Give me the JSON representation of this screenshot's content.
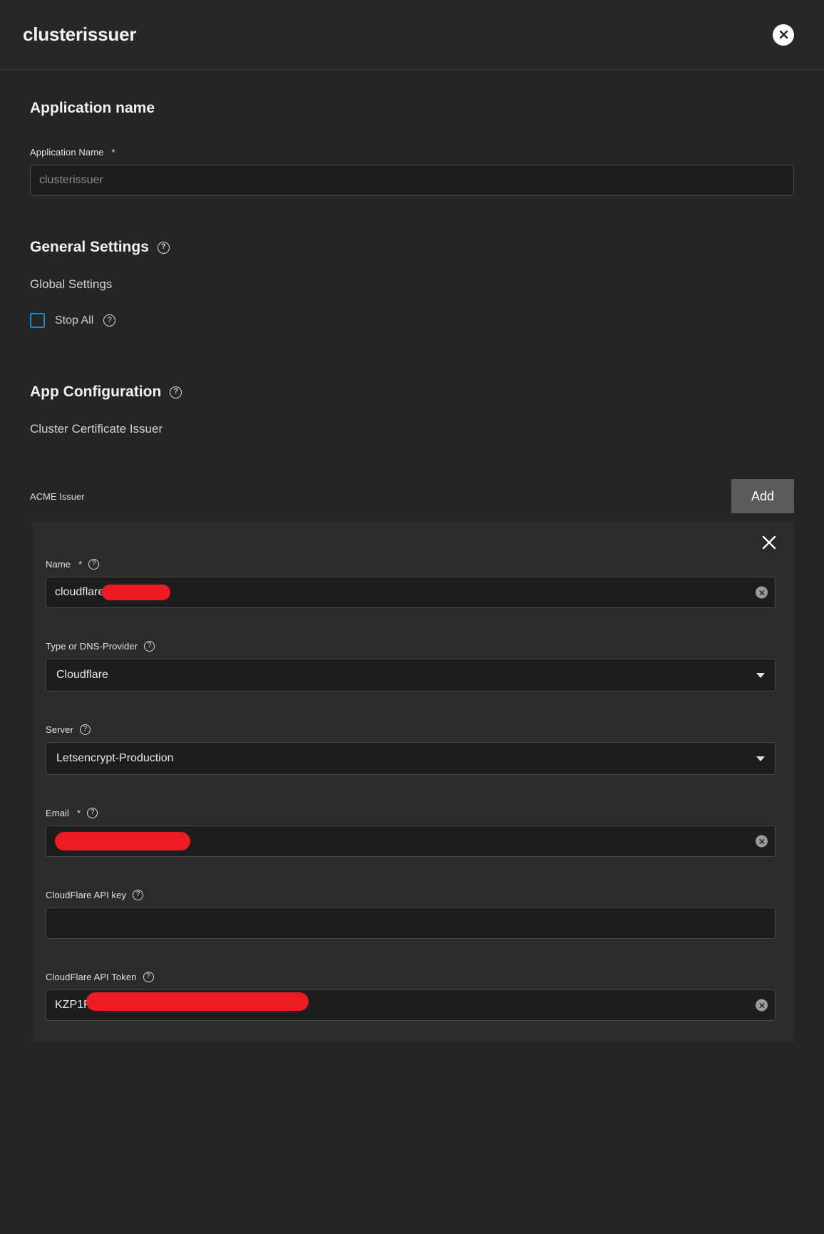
{
  "header": {
    "title": "clusterissuer",
    "close_icon": "close-icon"
  },
  "app_name_section": {
    "heading": "Application name",
    "field_label": "Application Name",
    "required_mark": "*",
    "input_placeholder": "clusterissuer",
    "input_value": ""
  },
  "general_settings": {
    "heading": "General Settings",
    "help_icon": "help-circle-icon",
    "subheading": "Global Settings",
    "stop_all": {
      "label": "Stop All",
      "checked": false,
      "help_icon": "help-circle-icon"
    }
  },
  "app_configuration": {
    "heading": "App Configuration",
    "help_icon": "help-circle-icon",
    "subheading": "Cluster Certificate Issuer",
    "acme": {
      "label": "ACME Issuer",
      "add_button": "Add"
    },
    "issuer_card": {
      "close_icon": "close-x-icon",
      "fields": [
        {
          "label": "Name",
          "required": "*",
          "help_icon": "help-circle-icon",
          "type": "text",
          "value": "cloudflare",
          "redacted": true,
          "clear_icon": "clear-circle-icon"
        },
        {
          "label": "Type or DNS-Provider",
          "required": "",
          "help_icon": "help-circle-icon",
          "type": "select",
          "value": "Cloudflare",
          "caret_icon": "chevron-down-icon"
        },
        {
          "label": "Server",
          "required": "",
          "help_icon": "help-circle-icon",
          "type": "select",
          "value": "Letsencrypt-Production",
          "caret_icon": "chevron-down-icon"
        },
        {
          "label": "Email",
          "required": "*",
          "help_icon": "help-circle-icon",
          "type": "text",
          "value": "",
          "redacted": true,
          "clear_icon": "clear-circle-icon"
        },
        {
          "label": "CloudFlare API key",
          "required": "",
          "help_icon": "help-circle-icon",
          "type": "text",
          "value": ""
        },
        {
          "label": "CloudFlare API Token",
          "required": "",
          "help_icon": "help-circle-icon",
          "type": "text",
          "value": "KZP1F",
          "redacted": true,
          "clear_icon": "clear-circle-icon"
        }
      ]
    }
  },
  "colors": {
    "page_bg": "#252525",
    "header_bg": "#272727",
    "card_bg": "#2b2b2b",
    "input_bg": "#1d1d1d",
    "input_border": "#484848",
    "checkbox_accent": "#1e88c7",
    "add_button_bg": "#5b5b5b",
    "redaction": "#ed1c24"
  },
  "glyphs": {
    "question": "?",
    "asterisk": "*"
  }
}
